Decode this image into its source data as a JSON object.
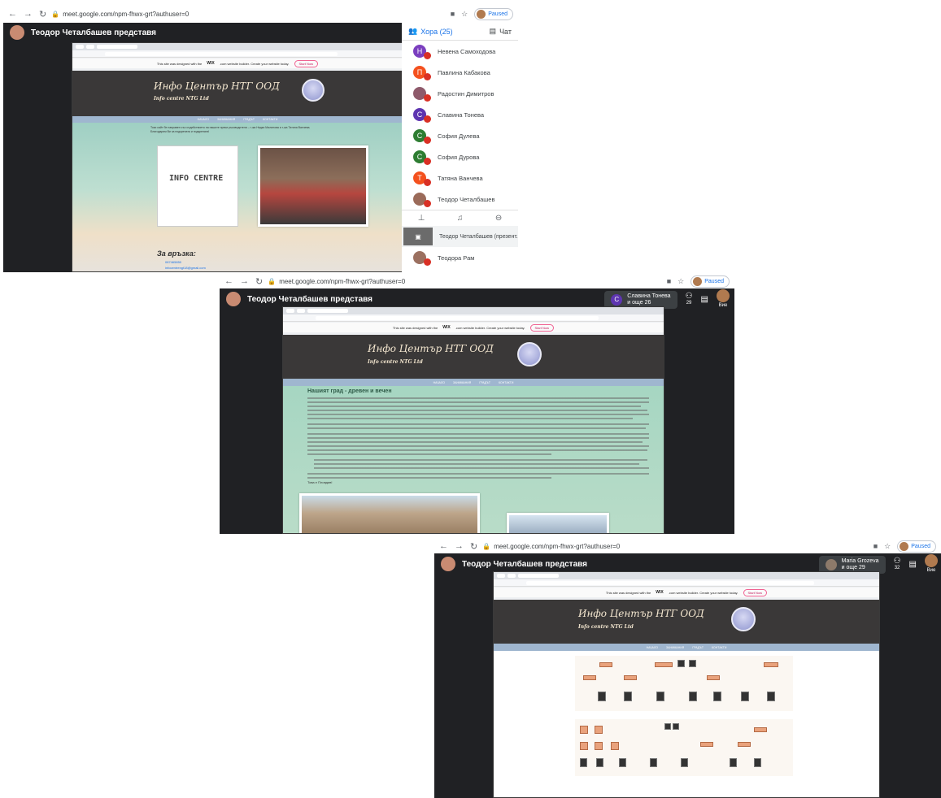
{
  "browser": {
    "url": "meet.google.com/npm-fhwx-grt?authuser=0",
    "profile_status": "Paused"
  },
  "meet": {
    "presenter_title": "Теодор Четалбашев представя",
    "people_tab": "Хора (25)",
    "chat_tab": "Чат",
    "participants": [
      {
        "initial": "Н",
        "name": "Невена Самоходова",
        "color": "#7b3fbf"
      },
      {
        "initial": "П",
        "name": "Павлина Кабакова",
        "color": "#f4511e"
      },
      {
        "initial": "",
        "name": "Радостин Димитров",
        "color": "#8e5a6b"
      },
      {
        "initial": "С",
        "name": "Славина Тонева",
        "color": "#5e35b1"
      },
      {
        "initial": "С",
        "name": "София Дулева",
        "color": "#2e7d32"
      },
      {
        "initial": "С",
        "name": "София Дурова",
        "color": "#2e7d32"
      },
      {
        "initial": "Т",
        "name": "Татяна Ванчева",
        "color": "#f4511e"
      },
      {
        "initial": "",
        "name": "Теодор Четалбашев",
        "color": "#9b6b5a"
      }
    ],
    "presenting_row": "Теодор Четалбашев (презент.",
    "last_participant": "Теодора Рам",
    "shot2": {
      "speaker_name": "Славина Тонева",
      "speaker_more": "и още 26",
      "people_count": "29",
      "you_label": "Вие"
    },
    "shot3": {
      "speaker_name": "Maria Grozeva",
      "speaker_more": "и още 29",
      "people_count": "32",
      "you_label": "Вие"
    }
  },
  "site": {
    "wix_banner_pre": "This site was designed with the",
    "wix_brand": "WIX",
    "wix_banner_post": ".com website builder. Create your website today.",
    "wix_button": "Start Now",
    "name_bg": "Инфо Център НТГ ООД",
    "name_en": "Info centre NTG Ltd",
    "logo_text": "INFO CENTRE",
    "menu": [
      "НАЧАЛО",
      "ЗАНИМАНИЯ",
      "ГРАДЪТ",
      "КОНТАКТИ"
    ],
    "intro": "Този сайт бе направен със съдействието на нашите преки ръководители – г-жа Недка Малинова и г-жа Татяна Ванчева. Благодарим Ви за подкрепата и подкрепата!",
    "contact_heading": "За връзка:",
    "contact_phone": "087465850",
    "contact_email": "infocentrengt18@gmail.com",
    "page2_heading": "Нашият град - древен и вечен",
    "page2_last_line": "Това е Пловдив!"
  }
}
